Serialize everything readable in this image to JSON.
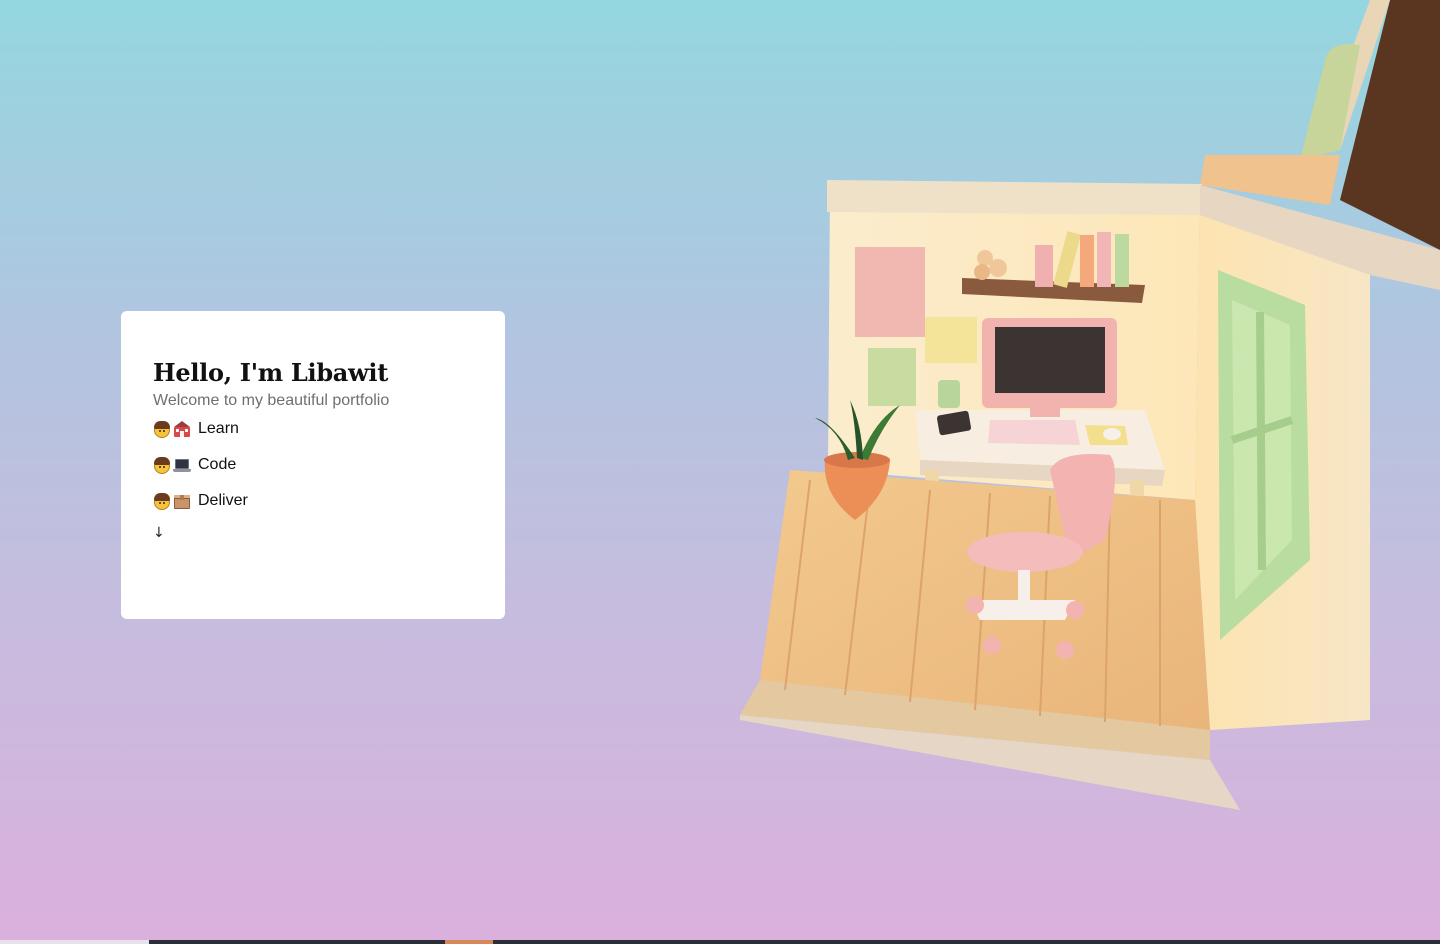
{
  "intro": {
    "title": "Hello, I'm Libawit",
    "subtitle": "Welcome to my beautiful portfolio",
    "steps": [
      {
        "icons": [
          "boy-icon",
          "school-icon"
        ],
        "label": "Learn"
      },
      {
        "icons": [
          "boy-icon",
          "laptop-icon"
        ],
        "label": "Code"
      },
      {
        "icons": [
          "boy-icon",
          "package-icon"
        ],
        "label": "Deliver"
      }
    ],
    "scroll_arrow": "↓"
  },
  "colors": {
    "background_top": "#94d7e0",
    "background_bottom": "#dbb0dc",
    "card_background": "#ffffff",
    "title_color": "#111111",
    "subtitle_color": "#6f6f6f",
    "accent": "#d5895b"
  }
}
